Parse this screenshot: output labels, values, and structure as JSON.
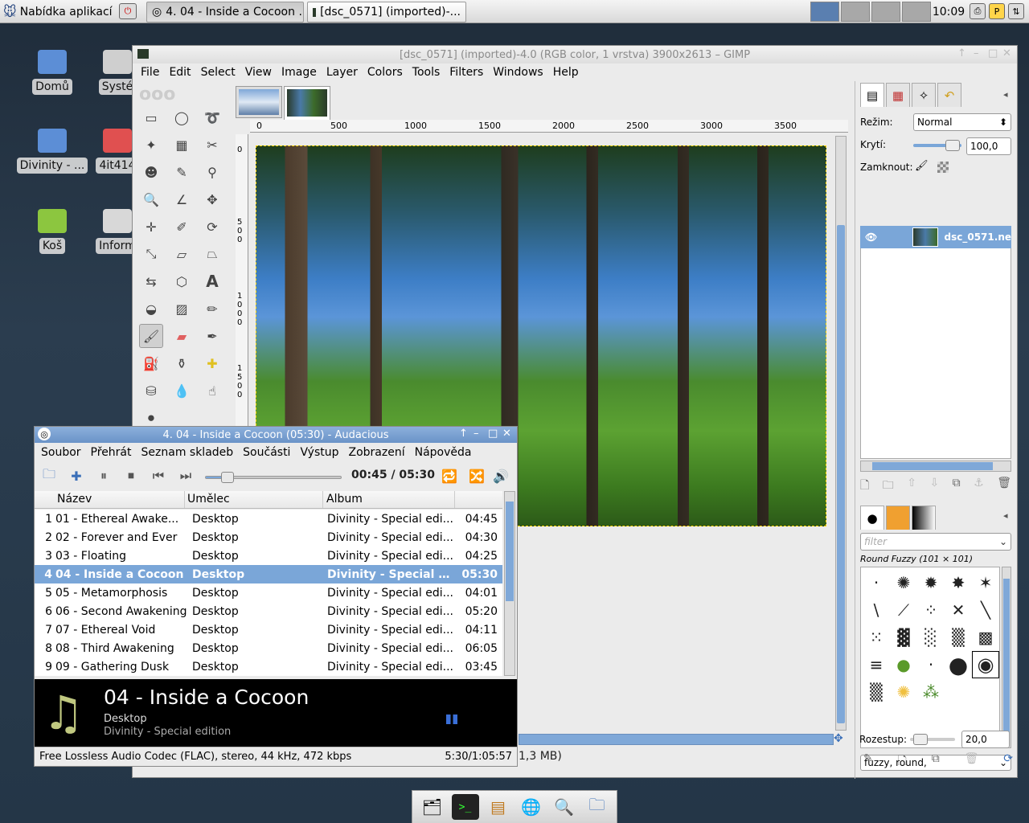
{
  "panel": {
    "menu_label": "Nabídka aplikací",
    "tasks": [
      "4. 04 - Inside a Cocoon ...",
      "[dsc_0571] (imported)-..."
    ],
    "clock": "10:09"
  },
  "desktop": {
    "icons": [
      "Domů",
      "Systé",
      "Divinity - ...",
      "4it414",
      "Koš",
      "Inform"
    ]
  },
  "gimp": {
    "title": "[dsc_0571] (imported)-4.0 (RGB color, 1 vrstva) 3900x2613 – GIMP",
    "menu": [
      "File",
      "Edit",
      "Select",
      "View",
      "Image",
      "Layer",
      "Colors",
      "Tools",
      "Filters",
      "Windows",
      "Help"
    ],
    "hruler_ticks": [
      "0",
      "500",
      "1000",
      "1500",
      "2000",
      "2500",
      "3000",
      "3500"
    ],
    "vruler_ticks": [
      "0",
      "500",
      "1000",
      "1500"
    ],
    "status_text": "1,3 MB)",
    "dock": {
      "mode_label": "Režim:",
      "mode_value": "Normal",
      "opacity_label": "Krytí:",
      "opacity_value": "100,0",
      "lock_label": "Zamknout:",
      "layer_name": "dsc_0571.ne",
      "brush_filter_placeholder": "filter",
      "brush_name": "Round Fuzzy (101 × 101)",
      "brush_tags": "fuzzy, round,",
      "spacing_label": "Rozestup:",
      "spacing_value": "20,0"
    }
  },
  "audacious": {
    "title": "4. 04 - Inside a Cocoon (05:30) - Audacious",
    "menu": [
      "Soubor",
      "Přehrát",
      "Seznam skladeb",
      "Součásti",
      "Výstup",
      "Zobrazení",
      "Nápověda"
    ],
    "time": "00:45 / 05:30",
    "progress": 0.136,
    "columns": [
      "Název",
      "Umělec",
      "Album"
    ],
    "tracks": [
      {
        "n": "1",
        "title": "01 - Ethereal Awake...",
        "artist": "Desktop",
        "album": "Divinity - Special edi...",
        "dur": "04:45"
      },
      {
        "n": "2",
        "title": "02 - Forever and Ever",
        "artist": "Desktop",
        "album": "Divinity - Special edi...",
        "dur": "04:30"
      },
      {
        "n": "3",
        "title": "03 - Floating",
        "artist": "Desktop",
        "album": "Divinity - Special edi...",
        "dur": "04:25"
      },
      {
        "n": "4",
        "title": "04 - Inside a Cocoon",
        "artist": "Desktop",
        "album": "Divinity - Special e...",
        "dur": "05:30"
      },
      {
        "n": "5",
        "title": "05 - Metamorphosis",
        "artist": "Desktop",
        "album": "Divinity - Special edi...",
        "dur": "04:01"
      },
      {
        "n": "6",
        "title": "06 - Second Awakening",
        "artist": "Desktop",
        "album": "Divinity - Special edi...",
        "dur": "05:20"
      },
      {
        "n": "7",
        "title": "07 - Ethereal Void",
        "artist": "Desktop",
        "album": "Divinity - Special edi...",
        "dur": "04:11"
      },
      {
        "n": "8",
        "title": "08 - Third Awakening",
        "artist": "Desktop",
        "album": "Divinity - Special edi...",
        "dur": "06:05"
      },
      {
        "n": "9",
        "title": "09 - Gathering Dusk",
        "artist": "Desktop",
        "album": "Divinity - Special edi...",
        "dur": "03:45"
      }
    ],
    "now_title": "04 - Inside a Cocoon",
    "now_artist": "Desktop",
    "now_album": "Divinity - Special edition",
    "codec": "Free Lossless Audio Codec (FLAC), stereo, 44 kHz, 472 kbps",
    "total": "5:30/1:05:57"
  }
}
